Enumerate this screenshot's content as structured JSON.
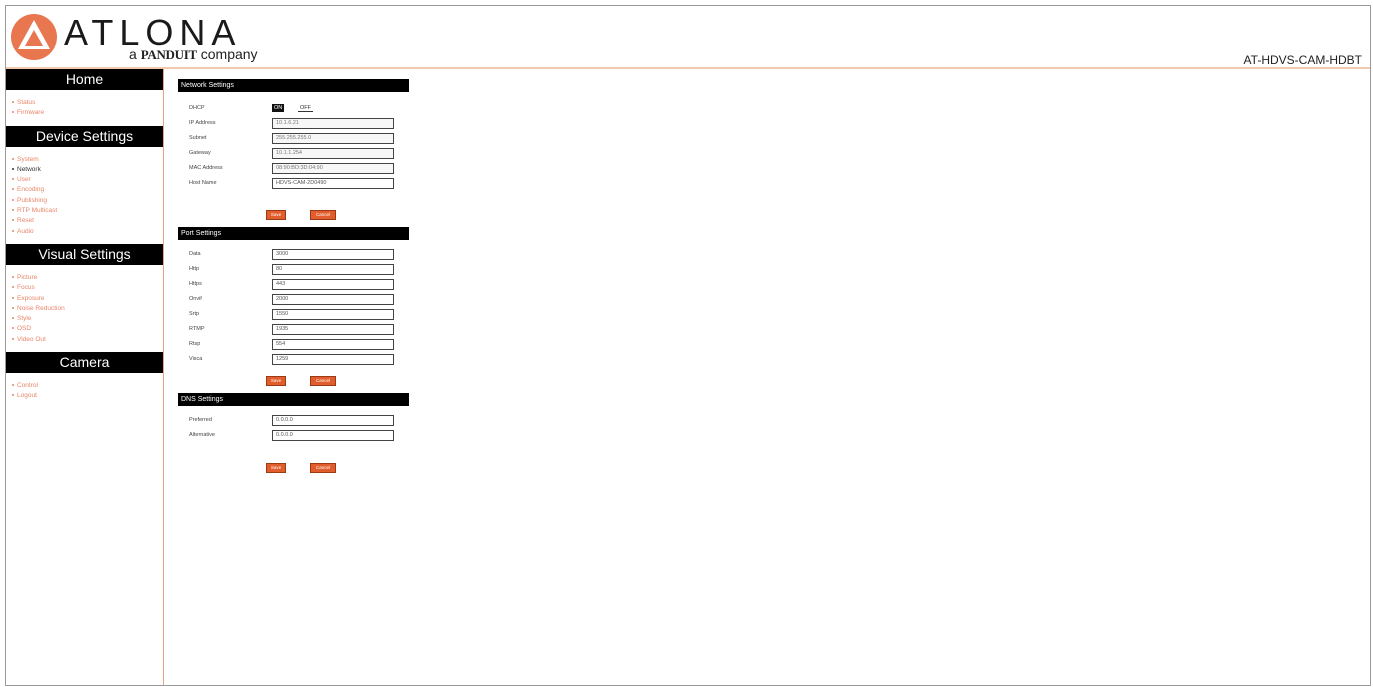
{
  "header": {
    "logo_word": "ATLONA",
    "logo_sub_prefix": "a",
    "logo_sub_brand": "PANDUIT",
    "logo_sub_suffix": "company",
    "model": "AT-HDVS-CAM-HDBT",
    "accent_color": "#e8764f"
  },
  "sidebar": {
    "sections": [
      {
        "title": "Home",
        "items": [
          {
            "label": "Status"
          },
          {
            "label": "Firmware"
          }
        ]
      },
      {
        "title": "Device Settings",
        "items": [
          {
            "label": "System"
          },
          {
            "label": "Network",
            "active": true
          },
          {
            "label": "User"
          },
          {
            "label": "Encoding"
          },
          {
            "label": "Publishing"
          },
          {
            "label": "RTP Multicast"
          },
          {
            "label": "Reset"
          },
          {
            "label": "Audio"
          }
        ]
      },
      {
        "title": "Visual Settings",
        "items": [
          {
            "label": "Picture"
          },
          {
            "label": "Focus"
          },
          {
            "label": "Exposure"
          },
          {
            "label": "Noise Reduction"
          },
          {
            "label": "Style"
          },
          {
            "label": "OSD"
          },
          {
            "label": "Video Out"
          }
        ]
      },
      {
        "title": "Camera",
        "items": [
          {
            "label": "Control"
          },
          {
            "label": "Logout"
          }
        ]
      }
    ]
  },
  "network": {
    "title": "Network Settings",
    "dhcp_label": "DHCP",
    "dhcp_on": "ON",
    "dhcp_off": "OFF",
    "fields": [
      {
        "label": "IP Address",
        "value": "10.1.6.21"
      },
      {
        "label": "Subnet",
        "value": "255.255.255.0"
      },
      {
        "label": "Gateway",
        "value": "10.1.1.254"
      },
      {
        "label": "MAC Address",
        "value": "08:90:BD:3D:04:90"
      },
      {
        "label": "Host Name",
        "value": "HDVS-CAM-2D0490"
      }
    ],
    "save_label": "Save",
    "cancel_label": "Cancel"
  },
  "ports": {
    "title": "Port Settings",
    "fields": [
      {
        "label": "Data",
        "value": "3000"
      },
      {
        "label": "Http",
        "value": "80"
      },
      {
        "label": "Https",
        "value": "443"
      },
      {
        "label": "Onvif",
        "value": "2000"
      },
      {
        "label": "Srtp",
        "value": "1550"
      },
      {
        "label": "RTMP",
        "value": "1935"
      },
      {
        "label": "Rtsp",
        "value": "554"
      },
      {
        "label": "Visca",
        "value": "1259"
      }
    ],
    "save_label": "Save",
    "cancel_label": "Cancel"
  },
  "dns": {
    "title": "DNS Settings",
    "fields": [
      {
        "label": "Preferred",
        "value": "0.0.0.0"
      },
      {
        "label": "Alternative",
        "value": "0.0.0.0"
      }
    ],
    "save_label": "Save",
    "cancel_label": "Cancel"
  }
}
